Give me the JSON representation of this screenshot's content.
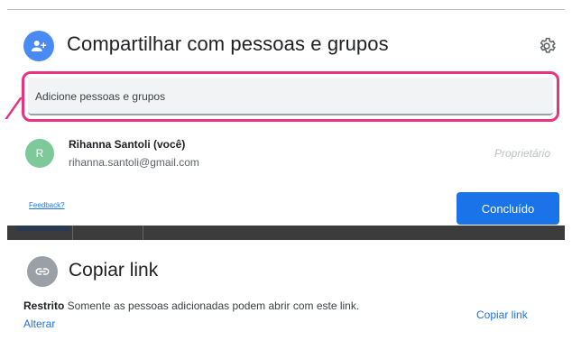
{
  "share": {
    "title": "Compartilhar com pessoas e grupos",
    "input_placeholder": "Adicione pessoas e grupos",
    "person": {
      "initial": "R",
      "name": "Rihanna Santoli (você)",
      "email": "rihanna.santoli@gmail.com",
      "role": "Proprietário"
    },
    "feedback_label": "Feedback?",
    "done_label": "Concluído"
  },
  "link": {
    "title": "Copiar link",
    "restriction_label": "Restrito",
    "restriction_text": " Somente as pessoas adicionadas podem abrir com este link.",
    "change_label": "Alterar",
    "copy_label": "Copiar link"
  },
  "colors": {
    "accent": "#1a73e8",
    "highlight": "#e8337d"
  }
}
